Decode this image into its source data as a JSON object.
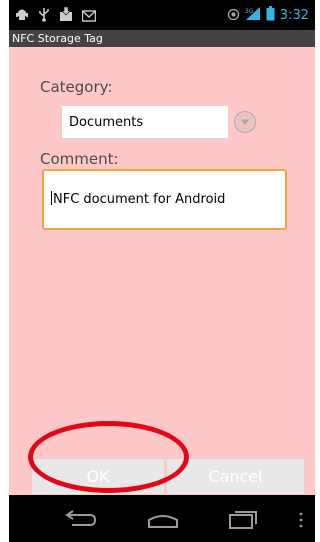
{
  "status_bar": {
    "time": "3:32",
    "network": "3G"
  },
  "app": {
    "title": "NFC Storage Tag"
  },
  "form": {
    "category_label": "Category:",
    "category_value": "Documents",
    "comment_label": "Comment:",
    "comment_value": "NFC document for Android"
  },
  "buttons": {
    "ok_label": "OK",
    "cancel_label": "Cancel"
  },
  "colors": {
    "background": "#ffc8c8",
    "focus_border": "#f2a33c",
    "annotation_ring": "#e30613",
    "clock": "#33b5e5"
  },
  "icons": [
    "usb-debug-icon",
    "usb-icon",
    "download-icon",
    "gmail-icon",
    "rotate-icon",
    "signal-icon",
    "battery-icon",
    "back-icon",
    "home-icon",
    "recent-apps-icon",
    "menu-overflow-icon",
    "spinner-arrow-icon"
  ]
}
